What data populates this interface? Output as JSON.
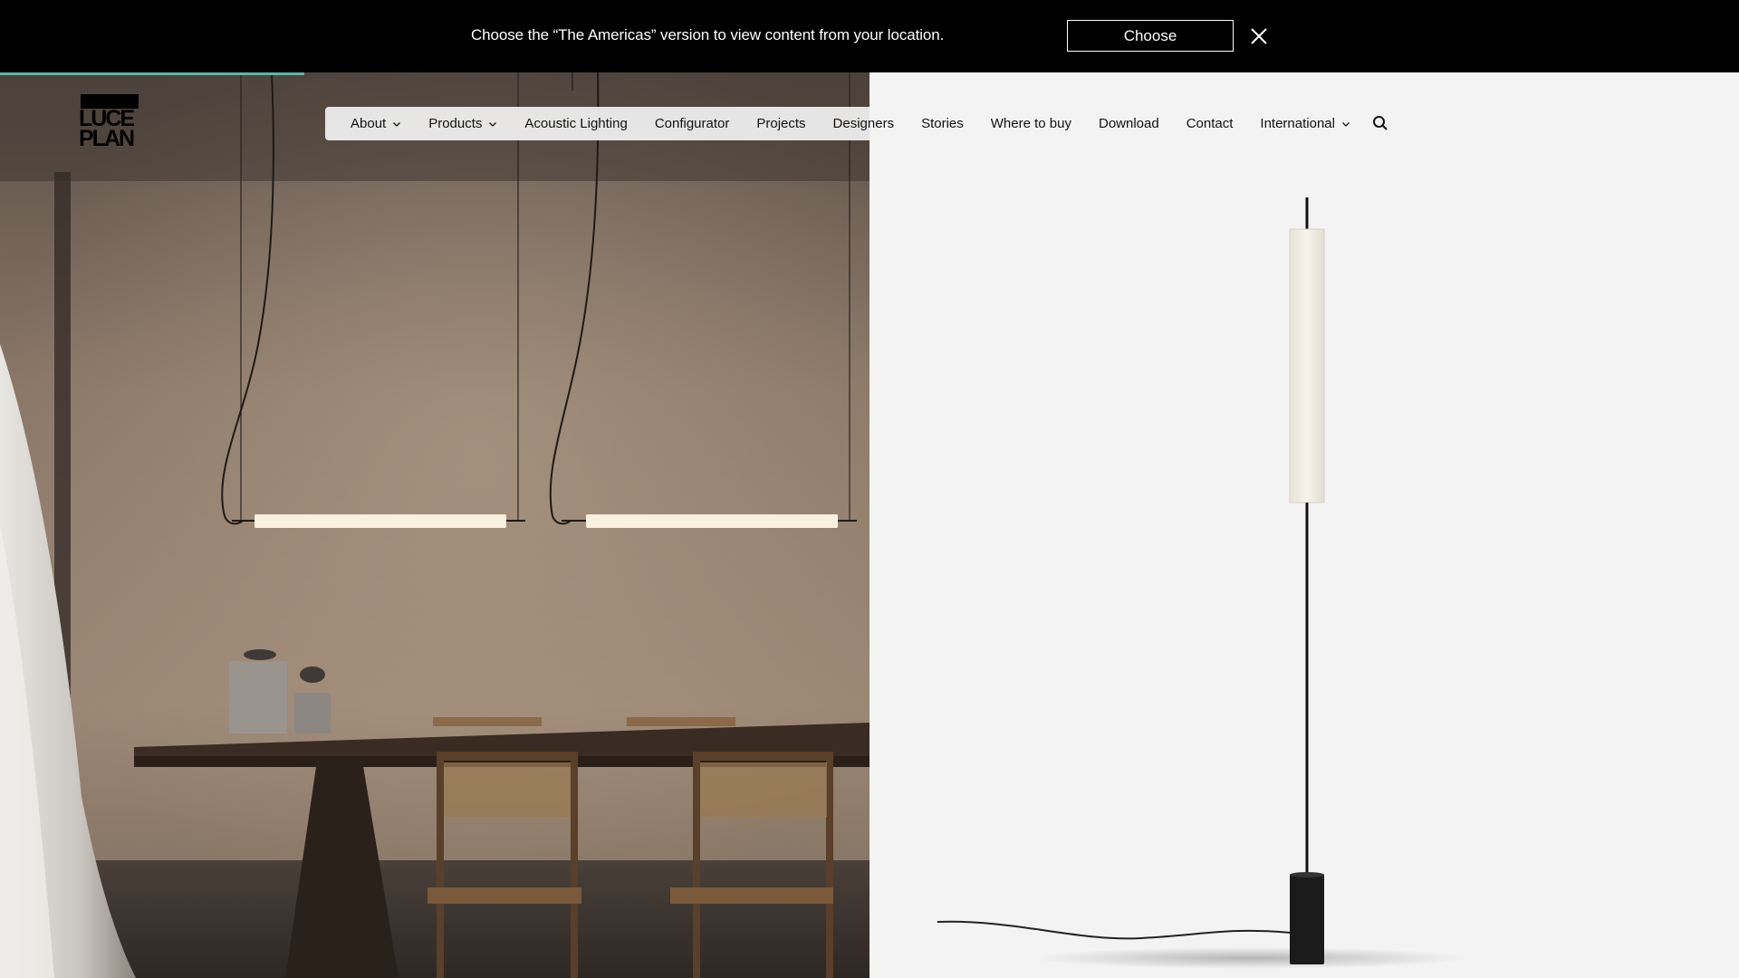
{
  "banner": {
    "message": "Choose the “The Americas” version to view content from your location.",
    "choose_label": "Choose",
    "close_icon": "close-icon"
  },
  "progress": {
    "value": 0.175,
    "color": "#5fb5a0"
  },
  "logo": {
    "line1": "LUCE",
    "line2": "PLAN"
  },
  "nav": {
    "items": [
      {
        "label": "About",
        "has_dropdown": true
      },
      {
        "label": "Products",
        "has_dropdown": true
      },
      {
        "label": "Acoustic Lighting",
        "has_dropdown": false
      },
      {
        "label": "Configurator",
        "has_dropdown": false
      },
      {
        "label": "Projects",
        "has_dropdown": false
      },
      {
        "label": "Designers",
        "has_dropdown": false
      },
      {
        "label": "Stories",
        "has_dropdown": false
      },
      {
        "label": "Where to buy",
        "has_dropdown": false
      },
      {
        "label": "Download",
        "has_dropdown": false
      },
      {
        "label": "Contact",
        "has_dropdown": false
      },
      {
        "label": "International",
        "has_dropdown": true
      }
    ],
    "search_icon": "search-icon"
  },
  "hero": {
    "left_image": "dining-room-with-pendant-lights",
    "right_image": "floor-lamp-product"
  }
}
